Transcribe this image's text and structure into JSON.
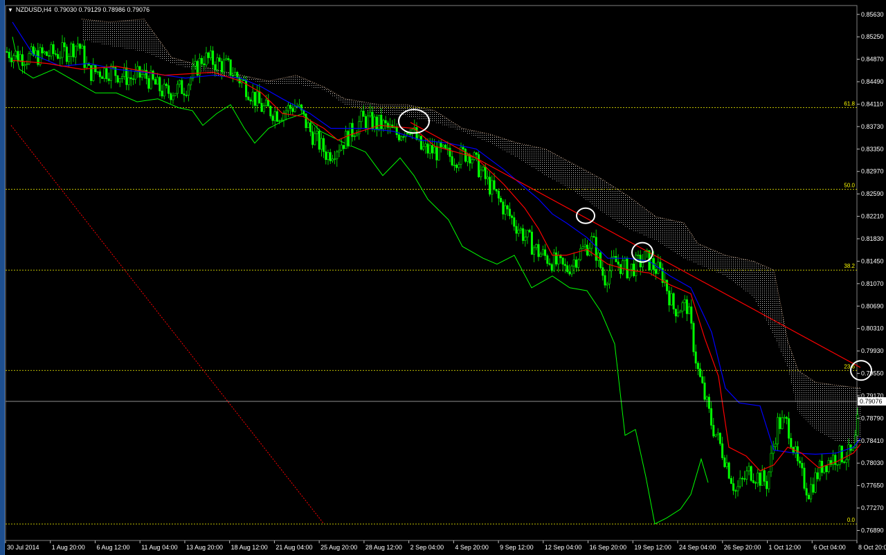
{
  "header": {
    "dropdown_icon": "triangle-down-icon",
    "symbol": "NZDUSD,H4",
    "ohlc": "0.79030 0.79129 0.78986 0.79076"
  },
  "colors": {
    "background": "#000000",
    "candles": "#00ff00",
    "tenkan": "#ff0000",
    "kijun": "#0000ff",
    "chikou": "#00ff00",
    "cloud": "#ffffff",
    "fib": "#ffff00",
    "trendline": "#ff0000",
    "price_line": "#c0c0c0"
  },
  "chart_data": {
    "type": "line",
    "symbol": "NZDUSD",
    "timeframe": "H4",
    "price_axis_ticks": [
      "0.85630",
      "0.85250",
      "0.84870",
      "0.84490",
      "0.84110",
      "0.83730",
      "0.83350",
      "0.82970",
      "0.82590",
      "0.82210",
      "0.81830",
      "0.81450",
      "0.81070",
      "0.80690",
      "0.80310",
      "0.79930",
      "0.79550",
      "0.79170",
      "0.78790",
      "0.78410",
      "0.78030",
      "0.77650",
      "0.77270",
      "0.76890"
    ],
    "time_axis_ticks": [
      "30 Jul 2014",
      "1 Aug 20:00",
      "6 Aug 12:00",
      "11 Aug 04:00",
      "13 Aug 20:00",
      "18 Aug 12:00",
      "21 Aug 04:00",
      "25 Aug 20:00",
      "28 Aug 12:00",
      "2 Sep 04:00",
      "4 Sep 20:00",
      "9 Sep 12:00",
      "12 Sep 04:00",
      "16 Sep 20:00",
      "19 Sep 12:00",
      "24 Sep 04:00",
      "26 Sep 20:00",
      "1 Oct 12:00",
      "6 Oct 04:00",
      "8 Oct 20:00"
    ],
    "ylim": [
      0.7672,
      0.8578
    ],
    "current_price": "0.79076",
    "fib_levels": [
      {
        "label": "61.8",
        "price": 0.8405
      },
      {
        "label": "50.0",
        "price": 0.8267
      },
      {
        "label": "38.2",
        "price": 0.813
      },
      {
        "label": "23.6",
        "price": 0.796
      },
      {
        "label": "0.0",
        "price": 0.77
      }
    ],
    "close_path": [
      [
        0,
        0.85
      ],
      [
        30,
        0.849
      ],
      [
        60,
        0.8495
      ],
      [
        90,
        0.85
      ],
      [
        105,
        0.8515
      ],
      [
        120,
        0.8465
      ],
      [
        150,
        0.8468
      ],
      [
        180,
        0.8455
      ],
      [
        200,
        0.846
      ],
      [
        230,
        0.843
      ],
      [
        260,
        0.844
      ],
      [
        285,
        0.849
      ],
      [
        320,
        0.8475
      ],
      [
        345,
        0.8445
      ],
      [
        370,
        0.8405
      ],
      [
        395,
        0.8395
      ],
      [
        420,
        0.841
      ],
      [
        440,
        0.8365
      ],
      [
        465,
        0.8325
      ],
      [
        490,
        0.835
      ],
      [
        515,
        0.8385
      ],
      [
        545,
        0.8375
      ],
      [
        565,
        0.836
      ],
      [
        585,
        0.8375
      ],
      [
        600,
        0.8335
      ],
      [
        625,
        0.833
      ],
      [
        650,
        0.832
      ],
      [
        670,
        0.833
      ],
      [
        690,
        0.829
      ],
      [
        720,
        0.8235
      ],
      [
        745,
        0.8195
      ],
      [
        770,
        0.816
      ],
      [
        790,
        0.8145
      ],
      [
        810,
        0.813
      ],
      [
        830,
        0.816
      ],
      [
        848,
        0.818
      ],
      [
        865,
        0.8115
      ],
      [
        880,
        0.8145
      ],
      [
        900,
        0.813
      ],
      [
        925,
        0.815
      ],
      [
        950,
        0.812
      ],
      [
        965,
        0.8065
      ],
      [
        985,
        0.807
      ],
      [
        1000,
        0.796
      ],
      [
        1020,
        0.787
      ],
      [
        1040,
        0.781
      ],
      [
        1055,
        0.7755
      ],
      [
        1075,
        0.779
      ],
      [
        1100,
        0.777
      ],
      [
        1115,
        0.787
      ],
      [
        1130,
        0.787
      ],
      [
        1145,
        0.7795
      ],
      [
        1160,
        0.7755
      ],
      [
        1180,
        0.78
      ],
      [
        1200,
        0.7815
      ],
      [
        1225,
        0.7818
      ],
      [
        1235,
        0.7905
      ]
    ],
    "tenkan_path": [
      [
        10,
        0.8485
      ],
      [
        60,
        0.848
      ],
      [
        110,
        0.847
      ],
      [
        160,
        0.8475
      ],
      [
        230,
        0.846
      ],
      [
        300,
        0.8465
      ],
      [
        340,
        0.845
      ],
      [
        370,
        0.843
      ],
      [
        400,
        0.8395
      ],
      [
        430,
        0.839
      ],
      [
        460,
        0.837
      ],
      [
        480,
        0.835
      ],
      [
        500,
        0.836
      ],
      [
        540,
        0.8375
      ],
      [
        590,
        0.837
      ],
      [
        620,
        0.834
      ],
      [
        650,
        0.833
      ],
      [
        680,
        0.832
      ],
      [
        720,
        0.8275
      ],
      [
        750,
        0.8235
      ],
      [
        770,
        0.82
      ],
      [
        790,
        0.8155
      ],
      [
        810,
        0.8155
      ],
      [
        840,
        0.8165
      ],
      [
        870,
        0.814
      ],
      [
        900,
        0.813
      ],
      [
        930,
        0.8125
      ],
      [
        960,
        0.8105
      ],
      [
        990,
        0.809
      ],
      [
        1010,
        0.8015
      ],
      [
        1030,
        0.795
      ],
      [
        1045,
        0.783
      ],
      [
        1070,
        0.7815
      ],
      [
        1090,
        0.779
      ],
      [
        1110,
        0.78
      ],
      [
        1130,
        0.783
      ],
      [
        1150,
        0.782
      ],
      [
        1175,
        0.7795
      ],
      [
        1200,
        0.7805
      ],
      [
        1225,
        0.782
      ],
      [
        1235,
        0.7835
      ]
    ],
    "kijun_path": [
      [
        10,
        0.855
      ],
      [
        40,
        0.8495
      ],
      [
        80,
        0.8475
      ],
      [
        120,
        0.848
      ],
      [
        160,
        0.847
      ],
      [
        200,
        0.8465
      ],
      [
        260,
        0.8455
      ],
      [
        300,
        0.846
      ],
      [
        340,
        0.8455
      ],
      [
        370,
        0.844
      ],
      [
        400,
        0.842
      ],
      [
        440,
        0.8395
      ],
      [
        470,
        0.837
      ],
      [
        520,
        0.837
      ],
      [
        560,
        0.8365
      ],
      [
        600,
        0.835
      ],
      [
        640,
        0.8345
      ],
      [
        680,
        0.8335
      ],
      [
        720,
        0.83
      ],
      [
        740,
        0.828
      ],
      [
        770,
        0.825
      ],
      [
        790,
        0.8225
      ],
      [
        810,
        0.821
      ],
      [
        840,
        0.8185
      ],
      [
        870,
        0.815
      ],
      [
        900,
        0.815
      ],
      [
        930,
        0.8145
      ],
      [
        960,
        0.812
      ],
      [
        990,
        0.81
      ],
      [
        1020,
        0.8025
      ],
      [
        1040,
        0.793
      ],
      [
        1060,
        0.7905
      ],
      [
        1090,
        0.79
      ],
      [
        1110,
        0.7825
      ],
      [
        1140,
        0.782
      ],
      [
        1170,
        0.7818
      ],
      [
        1200,
        0.782
      ],
      [
        1225,
        0.783
      ],
      [
        1235,
        0.7845
      ]
    ],
    "chikou_path": [
      [
        10,
        0.8525
      ],
      [
        20,
        0.847
      ],
      [
        40,
        0.8455
      ],
      [
        70,
        0.847
      ],
      [
        100,
        0.845
      ],
      [
        130,
        0.843
      ],
      [
        160,
        0.843
      ],
      [
        190,
        0.8415
      ],
      [
        220,
        0.842
      ],
      [
        250,
        0.8405
      ],
      [
        270,
        0.84
      ],
      [
        285,
        0.8375
      ],
      [
        305,
        0.8395
      ],
      [
        325,
        0.841
      ],
      [
        345,
        0.837
      ],
      [
        360,
        0.8345
      ],
      [
        380,
        0.837
      ],
      [
        405,
        0.8385
      ],
      [
        430,
        0.8395
      ],
      [
        455,
        0.8365
      ],
      [
        490,
        0.8345
      ],
      [
        520,
        0.833
      ],
      [
        545,
        0.829
      ],
      [
        570,
        0.832
      ],
      [
        590,
        0.829
      ],
      [
        610,
        0.825
      ],
      [
        640,
        0.8215
      ],
      [
        660,
        0.817
      ],
      [
        690,
        0.815
      ],
      [
        710,
        0.814
      ],
      [
        735,
        0.8155
      ],
      [
        760,
        0.81
      ],
      [
        790,
        0.812
      ],
      [
        815,
        0.81
      ],
      [
        840,
        0.8095
      ],
      [
        860,
        0.806
      ],
      [
        880,
        0.8005
      ],
      [
        895,
        0.785
      ],
      [
        910,
        0.786
      ],
      [
        925,
        0.778
      ],
      [
        938,
        0.77
      ],
      [
        955,
        0.771
      ],
      [
        975,
        0.7725
      ],
      [
        990,
        0.775
      ],
      [
        1005,
        0.781
      ],
      [
        1015,
        0.777
      ]
    ],
    "cloud_top": [
      [
        110,
        0.8555
      ],
      [
        150,
        0.855
      ],
      [
        200,
        0.8555
      ],
      [
        240,
        0.849
      ],
      [
        300,
        0.847
      ],
      [
        340,
        0.846
      ],
      [
        380,
        0.845
      ],
      [
        420,
        0.846
      ],
      [
        460,
        0.844
      ],
      [
        490,
        0.842
      ],
      [
        540,
        0.841
      ],
      [
        580,
        0.841
      ],
      [
        620,
        0.84
      ],
      [
        660,
        0.837
      ],
      [
        700,
        0.836
      ],
      [
        740,
        0.8345
      ],
      [
        780,
        0.8335
      ],
      [
        820,
        0.831
      ],
      [
        860,
        0.8285
      ],
      [
        900,
        0.8255
      ],
      [
        940,
        0.822
      ],
      [
        980,
        0.821
      ],
      [
        1000,
        0.8175
      ],
      [
        1040,
        0.8155
      ],
      [
        1080,
        0.8145
      ],
      [
        1110,
        0.813
      ],
      [
        1130,
        0.801
      ],
      [
        1145,
        0.796
      ],
      [
        1170,
        0.794
      ],
      [
        1200,
        0.7935
      ],
      [
        1235,
        0.793
      ]
    ],
    "cloud_bottom": [
      [
        110,
        0.852
      ],
      [
        150,
        0.851
      ],
      [
        200,
        0.85
      ],
      [
        240,
        0.848
      ],
      [
        300,
        0.846
      ],
      [
        340,
        0.8455
      ],
      [
        380,
        0.8445
      ],
      [
        420,
        0.8445
      ],
      [
        460,
        0.8435
      ],
      [
        490,
        0.841
      ],
      [
        540,
        0.8395
      ],
      [
        580,
        0.839
      ],
      [
        620,
        0.838
      ],
      [
        660,
        0.8365
      ],
      [
        700,
        0.8345
      ],
      [
        740,
        0.832
      ],
      [
        780,
        0.829
      ],
      [
        820,
        0.8265
      ],
      [
        860,
        0.823
      ],
      [
        900,
        0.82
      ],
      [
        940,
        0.818
      ],
      [
        980,
        0.815
      ],
      [
        1000,
        0.814
      ],
      [
        1040,
        0.812
      ],
      [
        1080,
        0.8085
      ],
      [
        1110,
        0.802
      ],
      [
        1130,
        0.7965
      ],
      [
        1145,
        0.789
      ],
      [
        1170,
        0.786
      ],
      [
        1200,
        0.784
      ],
      [
        1235,
        0.7835
      ]
    ],
    "trendline": [
      [
        585,
        0.838
      ],
      [
        1235,
        0.7965
      ]
    ],
    "circles": [
      [
        590,
        0.8382
      ],
      [
        838,
        0.8222
      ],
      [
        920,
        0.816
      ],
      [
        1236,
        0.796
      ]
    ],
    "fib_diagonal": [
      [
        8,
        0.8375
      ],
      [
        460,
        0.77
      ]
    ]
  }
}
